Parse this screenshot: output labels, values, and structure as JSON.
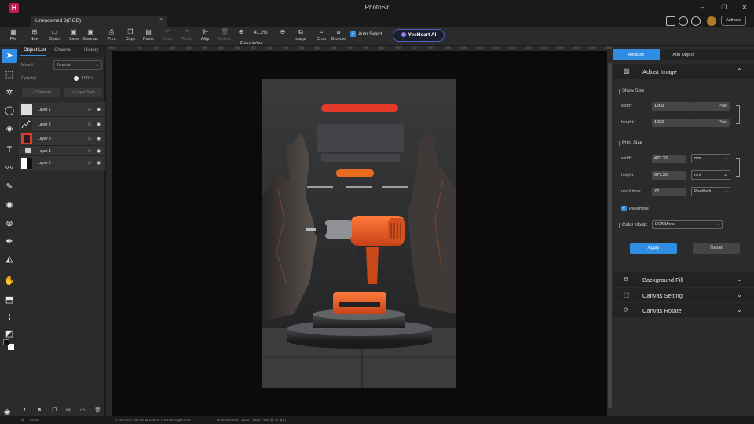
{
  "app": {
    "title": "PhotoSir",
    "logo_letter": "H",
    "activate_label": "Activate",
    "document_tab": "Unknowned 3(RGB)",
    "close_glyph": "×",
    "accent_color": "#2f8de4"
  },
  "toolbar": {
    "items": [
      {
        "label": "File",
        "icon": "file-icon",
        "glyph": "▦"
      },
      {
        "label": "New",
        "icon": "new-icon",
        "glyph": "⊞"
      },
      {
        "label": "Open",
        "icon": "open-icon",
        "glyph": "▭"
      },
      {
        "label": "Save",
        "icon": "save-icon",
        "glyph": "▣"
      },
      {
        "label": "Save as",
        "icon": "save-as-icon",
        "glyph": "▣"
      },
      {
        "label": "Print",
        "icon": "print-icon",
        "glyph": "⎙"
      },
      {
        "label": "Copy",
        "icon": "copy-icon",
        "glyph": "❐"
      },
      {
        "label": "Paste",
        "icon": "paste-icon",
        "glyph": "▤"
      },
      {
        "label": "Undo",
        "icon": "undo-icon",
        "glyph": "↶",
        "disabled": true
      },
      {
        "label": "Redo",
        "icon": "redo-icon",
        "glyph": "↷",
        "disabled": true
      },
      {
        "label": "Align",
        "icon": "align-icon",
        "glyph": "⊩"
      },
      {
        "label": "Delete",
        "icon": "delete-icon",
        "glyph": "🗑",
        "disabled": true
      },
      {
        "label": "Zoom in/out",
        "icon": "zoom-icon",
        "glyph": "⊕"
      },
      {
        "label": "stage",
        "icon": "stage-icon",
        "glyph": "⧉"
      },
      {
        "label": "Crop",
        "icon": "crop-icon",
        "glyph": "⌗"
      },
      {
        "label": "Browse",
        "icon": "browse-icon",
        "glyph": "⧈"
      }
    ],
    "zoom_value": "41.2%",
    "zoom_out_glyph": "⊖",
    "auto_select_label": "Auto Select",
    "auto_select_checked": true,
    "ai_button_label": "YeeHeart AI"
  },
  "tools": [
    {
      "name": "move-tool",
      "glyph": "➤",
      "active": true
    },
    {
      "name": "marquee-tool",
      "glyph": "⬚"
    },
    {
      "name": "magic-wand-tool",
      "glyph": "✲"
    },
    {
      "name": "lasso-tool",
      "glyph": "◯"
    },
    {
      "name": "fill-tool",
      "glyph": "◈"
    },
    {
      "name": "text-tool",
      "glyph": "T"
    },
    {
      "name": "brush-tool",
      "glyph": "〰"
    },
    {
      "name": "pen-brush-tool",
      "glyph": "✎"
    },
    {
      "name": "pattern-tool",
      "glyph": "✺"
    },
    {
      "name": "clone-tool",
      "glyph": "⊛"
    },
    {
      "name": "pen-tool",
      "glyph": "✒"
    },
    {
      "name": "shape-tool",
      "glyph": "◭"
    },
    {
      "name": "hand-tool",
      "glyph": "✋"
    },
    {
      "name": "transform-tool",
      "glyph": "⬒"
    },
    {
      "name": "eyedropper-tool",
      "glyph": "⌇"
    },
    {
      "name": "color-swap-tool",
      "glyph": "◩"
    }
  ],
  "layers_panel": {
    "tabs": [
      "Object List",
      "Channel",
      "History"
    ],
    "mixed_label": "Mixed:",
    "blend_mode": "Normal",
    "opacity_label": "Opacity:",
    "opacity_value": "100",
    "opacity_unit": "%",
    "clipmask_label": "Clipmask",
    "layer_style_label": "Layer Style",
    "layers": [
      {
        "name": "Layer 1",
        "thumb": "white"
      },
      {
        "name": "Layer 2",
        "thumb": "graph"
      },
      {
        "name": "Layer 3",
        "thumb": "drill"
      },
      {
        "name": "Layer 4",
        "thumb": "folder"
      },
      {
        "name": "Layer 5",
        "thumb": "bw"
      }
    ]
  },
  "canvas": {
    "ruler_unit": "Pixel",
    "ruler_ticks": [
      "0",
      "50",
      "100",
      "150",
      "200",
      "250",
      "300",
      "350",
      "400",
      "450",
      "500",
      "550",
      "600",
      "650",
      "700",
      "750",
      "800",
      "850",
      "900",
      "950",
      "1000",
      "1050",
      "1100",
      "1150",
      "1200",
      "1250",
      "1300",
      "1350",
      "1400",
      "1450",
      "1500"
    ],
    "poster_bg": "#2d2e30",
    "headline_color": "#e2392a",
    "pill_color": "#e86a1e"
  },
  "right_panel": {
    "tabs": [
      "Attribute",
      "Add Object"
    ],
    "adjust_image": {
      "title": "Adjust Image",
      "show_size": {
        "title": "Show Size",
        "width_label": "width:",
        "width_value": "1200",
        "width_unit": "Pixel",
        "height_label": "height:",
        "height_value": "1920",
        "height_unit": "Pixel"
      },
      "print_size": {
        "title": "Print Size",
        "width_label": "width:",
        "width_value": "423.33",
        "width_unit": "mm",
        "height_label": "height:",
        "height_value": "677.33",
        "height_unit": "mm",
        "resolution_label": "resolution:",
        "resolution_value": "72",
        "resolution_unit": "Pixel/inch"
      },
      "resample_label": "Resample",
      "resample_checked": true,
      "color_mode_label": "Color Mode:",
      "color_mode_value": "RGB Model",
      "apply_label": "Apply",
      "reset_label": "Reset"
    },
    "sections": [
      {
        "title": "Background Fill",
        "icon": "background-fill-icon",
        "glyph": "⧉"
      },
      {
        "title": "Canvas Setting",
        "icon": "canvas-setting-icon",
        "glyph": "⬚"
      },
      {
        "title": "Canvas Rotate",
        "icon": "canvas-rotate-icon",
        "glyph": "⟳"
      }
    ]
  },
  "status": {
    "close_label": "Close",
    "coords": "X:454.00 Y:202.00 W:235.00 H:58.00 Angle:0.00",
    "doc_info": "Unknowned 3 | 1200 * 1920 Pixel @ 72 dpi |"
  }
}
